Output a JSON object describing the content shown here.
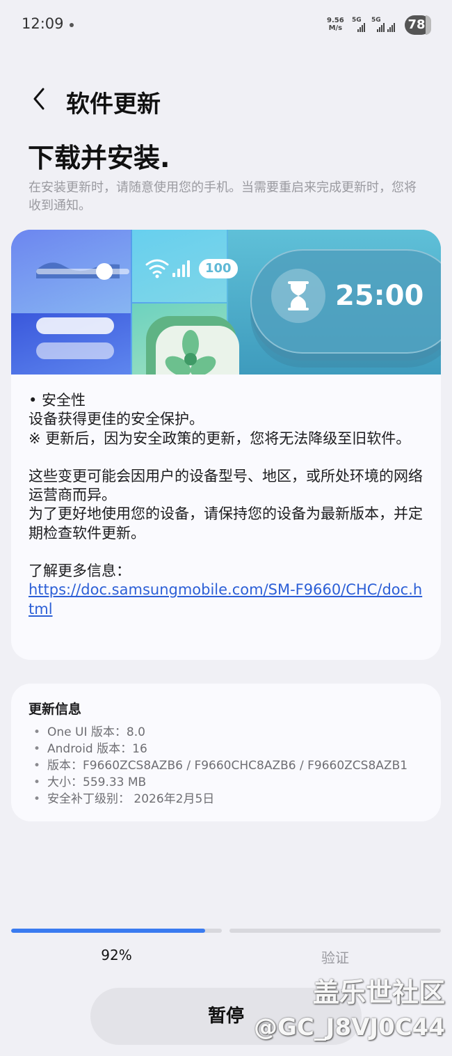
{
  "status_bar": {
    "time": "12:09",
    "net_speed_value": "9.56",
    "net_speed_unit": "M/s",
    "sim1": "5G",
    "sim2": "5G",
    "battery": "78"
  },
  "header": {
    "title": "软件更新"
  },
  "headline": "下载并安装.",
  "subtext": "在安装更新时，请随意使用您的手机。当需要重启来完成更新时，您将收到通知。",
  "banner": {
    "battery_text": "100",
    "timer_text": "25:00"
  },
  "release_notes": {
    "bullet": "• 安全性",
    "line1": "设备获得更佳的安全保护。",
    "line2": "※ 更新后，因为安全政策的更新，您将无法降级至旧软件。",
    "para2a": "这些变更可能会因用户的设备型号、地区，或所处环境的网络运营商而异。",
    "para2b": "为了更好地使用您的设备，请保持您的设备为最新版本，并定期检查软件更新。",
    "more_label": "了解更多信息：",
    "more_link": "https://doc.samsungmobile.com/SM-F9660/CHC/doc.html"
  },
  "update_info": {
    "title": "更新信息",
    "items": [
      "One UI 版本：8.0",
      "Android 版本：16",
      "版本：F9660ZCS8AZB6 / F9660CHC8AZB6 / F9660ZCS8AZB1",
      "大小：559.33 MB",
      "安全补丁级别： 2026年2月5日"
    ]
  },
  "progress": {
    "download_percent": 92,
    "download_label": "92%",
    "verify_label": "验证",
    "verify_percent": 0
  },
  "pause_button": "暂停",
  "watermark": {
    "line1": "盖乐世社区",
    "line2": "@GC_J8VJ0C44"
  },
  "colors": {
    "accent": "#3a7bf0",
    "link": "#2c5fd6",
    "background": "#f0f0f5",
    "card": "#fafafe"
  }
}
